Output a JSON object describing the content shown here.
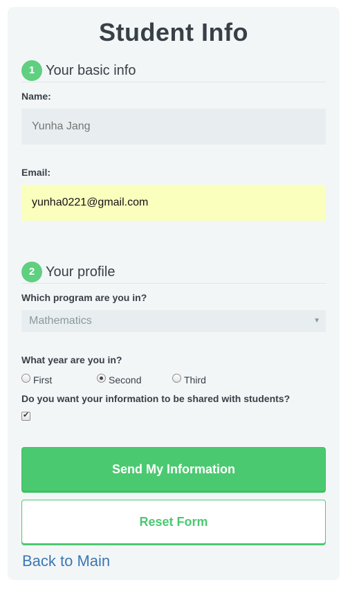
{
  "form": {
    "title": "Student Info",
    "section1": {
      "number": "1",
      "title": "Your basic info"
    },
    "name": {
      "label": "Name:",
      "placeholder": "Yunha Jang"
    },
    "email": {
      "label": "Email:",
      "value": "yunha0221@gmail.com"
    },
    "section2": {
      "number": "2",
      "title": "Your profile"
    },
    "program": {
      "label": "Which program are you in?",
      "selected": "Mathematics"
    },
    "year": {
      "label": "What year are you in?",
      "options": [
        "First",
        "Second",
        "Third"
      ],
      "selected": "Second"
    },
    "share": {
      "label": "Do you want your information to be shared with students?",
      "checked": true
    },
    "send_label": "Send My Information",
    "reset_label": "Reset Form",
    "back_label": "Back to Main"
  },
  "colors": {
    "accent": "#4bc970",
    "step_circle": "#5fcf80",
    "link": "#3a77b4",
    "autofill": "#faffbd",
    "field": "#e8eeef",
    "card": "#f3f6f7"
  }
}
